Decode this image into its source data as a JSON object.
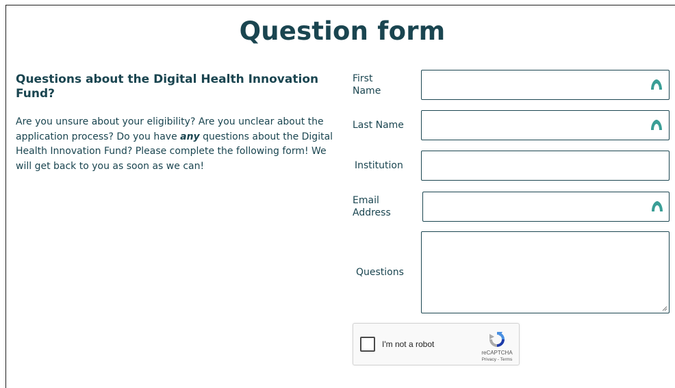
{
  "page": {
    "title": "Question form"
  },
  "intro": {
    "heading": "Questions about the Digital Health Innovation Fund?",
    "text_before": "Are you unsure about your eligibility? Are you unclear about the application process? Do you have ",
    "emphasis": "any",
    "text_after": " questions about the Digital Health Innovation Fund? Please complete the following form! We will get back to you as soon as we can!"
  },
  "form": {
    "first_name": {
      "label_line1": "First",
      "label_line2": "Name",
      "value": "",
      "icon": "password-manager-icon"
    },
    "last_name": {
      "label": "Last Name",
      "value": "",
      "icon": "password-manager-icon"
    },
    "institution": {
      "label": "Institution",
      "value": ""
    },
    "email": {
      "label_line1": "Email",
      "label_line2": "Address",
      "value": "",
      "icon": "password-manager-icon"
    },
    "questions": {
      "label": "Questions",
      "value": ""
    }
  },
  "captcha": {
    "label": "I'm not a robot",
    "brand": "reCAPTCHA",
    "privacy": "Privacy",
    "separator": " - ",
    "terms": "Terms",
    "checked": false,
    "icon": "recaptcha-logo-icon"
  },
  "colors": {
    "primary": "#1a4550",
    "icon_teal": "#3a9e96",
    "border": "#1a4550"
  }
}
